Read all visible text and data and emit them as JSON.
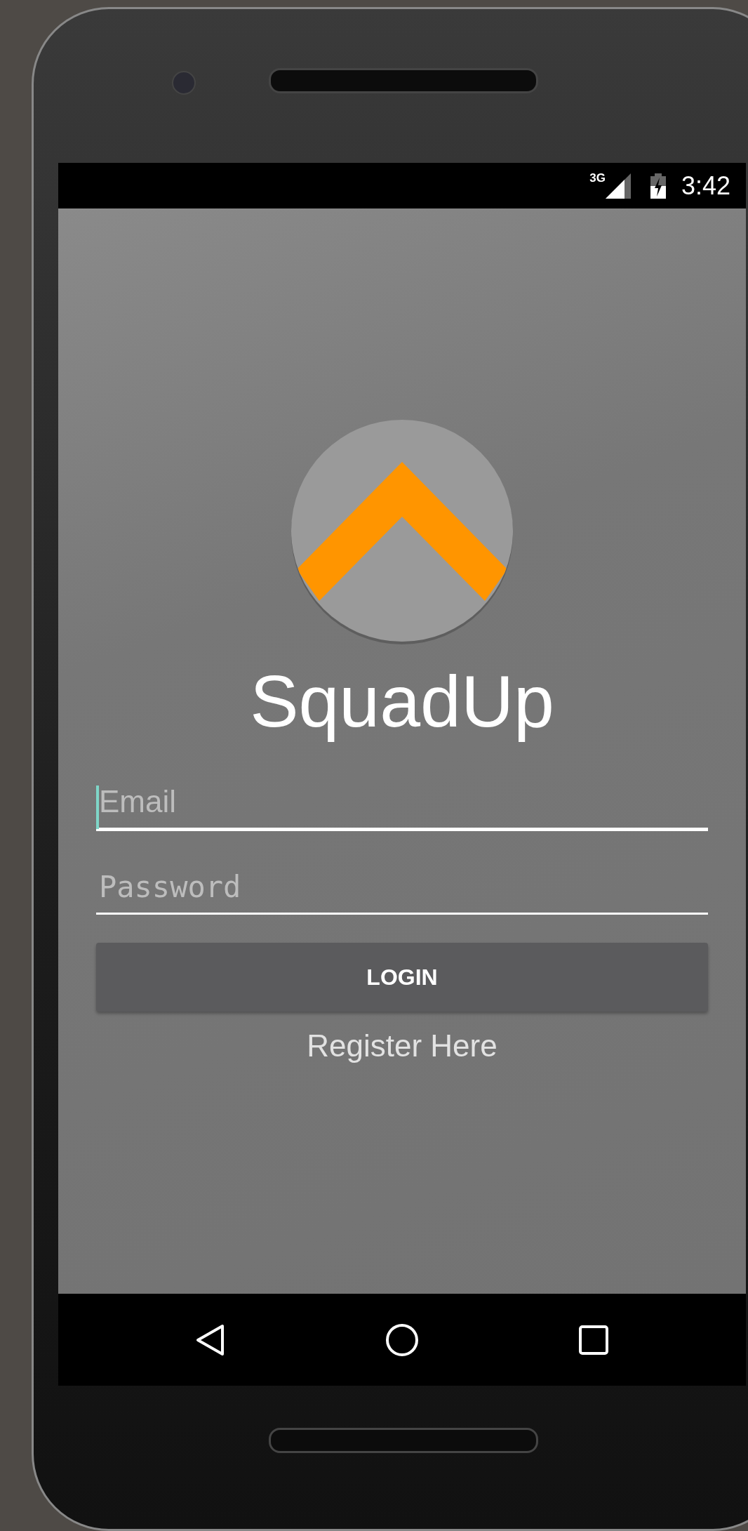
{
  "status_bar": {
    "network": "3G",
    "time": "3:42"
  },
  "app": {
    "title": "SquadUp",
    "fields": [
      {
        "placeholder": "Email",
        "kind": "text",
        "focused": true
      },
      {
        "placeholder": "Password",
        "kind": "password",
        "focused": false
      }
    ],
    "login_button": "LOGIN",
    "register_link": "Register Here"
  }
}
